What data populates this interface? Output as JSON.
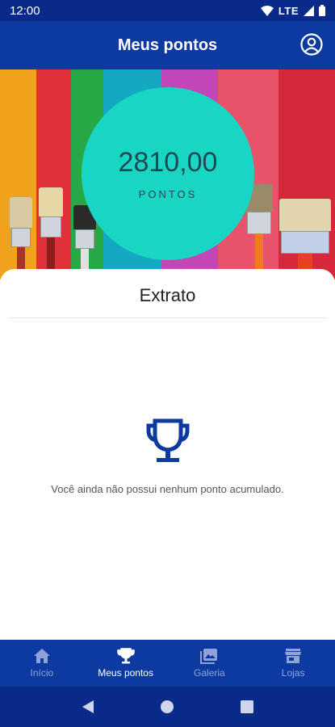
{
  "status_bar": {
    "time": "12:00",
    "network": "LTE"
  },
  "header": {
    "title": "Meus pontos"
  },
  "points": {
    "value": "2810,00",
    "label": "PONTOS"
  },
  "extrato": {
    "title": "Extrato",
    "empty_message": "Você ainda não possui nenhum ponto acumulado."
  },
  "bottom_nav": {
    "items": [
      {
        "label": "Início",
        "icon": "home-icon",
        "active": false
      },
      {
        "label": "Meus pontos",
        "icon": "trophy-icon",
        "active": true
      },
      {
        "label": "Galeria",
        "icon": "gallery-icon",
        "active": false
      },
      {
        "label": "Lojas",
        "icon": "store-icon",
        "active": false
      }
    ]
  },
  "colors": {
    "primary": "#0d3aa0",
    "status_bar": "#0a2a8a",
    "accent": "#19d6c4",
    "nav_inactive": "#8fa3d9"
  }
}
